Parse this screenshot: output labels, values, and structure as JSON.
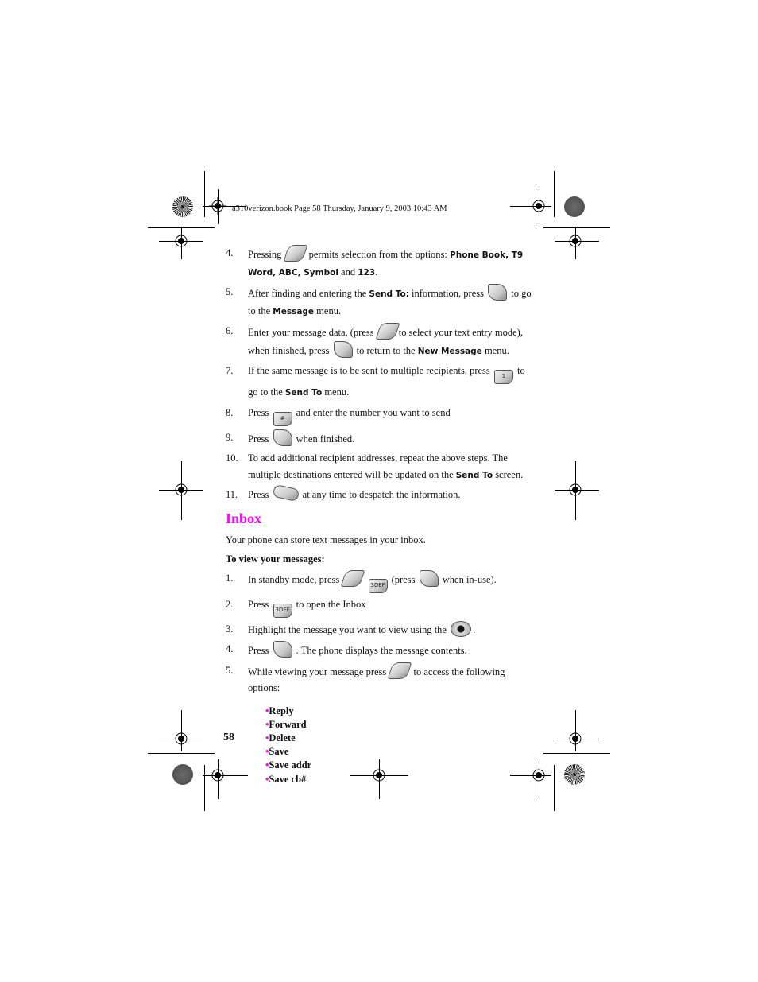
{
  "header": {
    "slug": "a310verizon.book  Page 58  Thursday, January 9, 2003  10:43 AM"
  },
  "steps_send": [
    {
      "num": "4.",
      "before": "Pressing",
      "key": "menu-key-icon",
      "after": "permits selection from the options:",
      "bold": "Phone Book, T9 Word, ABC, Symbol",
      "and": "and",
      "bold2": "123",
      "end": "."
    },
    {
      "num": "5.",
      "before": "After finding and entering the",
      "bold": "Send To:",
      "mid": "information, press",
      "key": "ok-key-icon",
      "after": "to go to the",
      "bold2": "Message",
      "end": "menu."
    },
    {
      "num": "6.",
      "before": "Enter your message data, (press",
      "key": "menu-key-icon",
      "mid": "to select your text entry mode), when finished, press",
      "key2": "ok-key-icon",
      "after": "to return to the",
      "bold": "New Message",
      "end": "menu."
    },
    {
      "num": "7.",
      "before": "If the same message is to be sent to multiple recipients, press",
      "key": "1-key-icon",
      "after": "to go to the",
      "bold": "Send To",
      "end": "menu."
    },
    {
      "num": "8.",
      "before": "Press",
      "key": "hash-key-icon",
      "after": "and enter the number you want to send"
    },
    {
      "num": "9.",
      "before": "Press",
      "key": "ok-key-icon",
      "after": "when finished."
    },
    {
      "num": "10.",
      "before": "To add additional recipient addresses, repeat the above steps. The multiple destinations entered will be updated on the",
      "bold": "Send To",
      "end": "screen."
    },
    {
      "num": "11.",
      "before": "Press",
      "key": "send-key-icon",
      "after": "at any time to despatch the information."
    }
  ],
  "inbox": {
    "title": "Inbox",
    "intro": "Your phone can store text messages in your inbox.",
    "subheading": "To view your messages:",
    "steps": [
      {
        "num": "1.",
        "before": "In standby mode, press",
        "mid": "(press",
        "after": "when in-use)."
      },
      {
        "num": "2.",
        "before": "Press",
        "after": "to open the Inbox"
      },
      {
        "num": "3.",
        "before": "Highlight the message you want to view using the",
        "after": "."
      },
      {
        "num": "4.",
        "before": "Press",
        "after": ". The phone displays the message contents."
      },
      {
        "num": "5.",
        "before": "While viewing your message press",
        "after": "to access the following options:"
      }
    ],
    "options": [
      "Reply",
      "Forward",
      "Delete",
      "Save",
      "Save addr",
      "Save cb#"
    ]
  },
  "keys": {
    "menu": "MENU",
    "ok": "OK",
    "one": "1",
    "three": "3DEF",
    "hash": "#",
    "send": "SEND"
  },
  "footer": {
    "page_number": "58"
  },
  "colors": {
    "accent": "#ff00ff"
  }
}
